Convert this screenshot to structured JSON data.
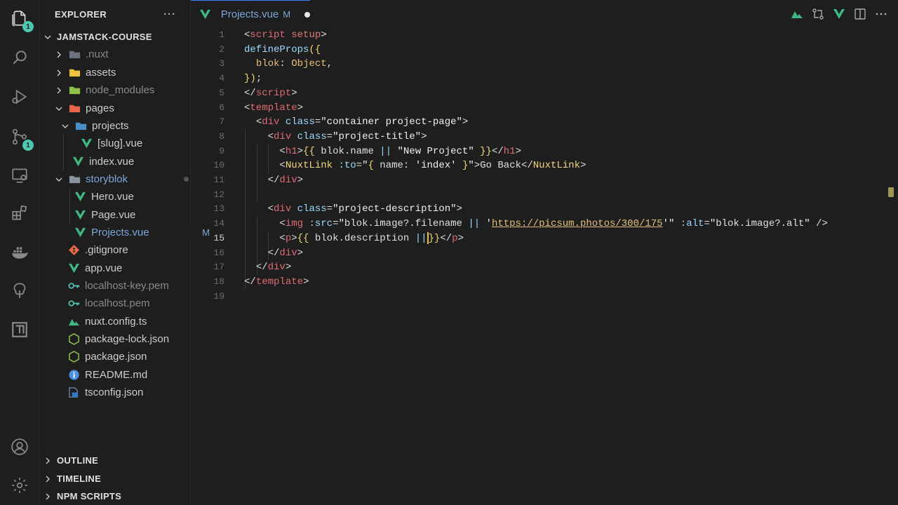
{
  "activity_bar": {
    "items": [
      {
        "name": "explorer-icon",
        "badge": "1"
      },
      {
        "name": "search-icon",
        "badge": ""
      },
      {
        "name": "run-debug-icon",
        "badge": ""
      },
      {
        "name": "source-control-icon",
        "badge": "1"
      },
      {
        "name": "remote-explorer-icon",
        "badge": ""
      },
      {
        "name": "extensions-icon",
        "badge": ""
      },
      {
        "name": "docker-icon",
        "badge": ""
      },
      {
        "name": "tree-icon",
        "badge": ""
      },
      {
        "name": "app-icon",
        "badge": ""
      }
    ],
    "bottom": [
      {
        "name": "account-icon"
      },
      {
        "name": "gear-icon"
      }
    ]
  },
  "sidebar": {
    "title": "EXPLORER",
    "more": "···",
    "root": "JAMSTACK-COURSE",
    "items": [
      {
        "label": ".nuxt",
        "type": "folder",
        "state": "collapsed",
        "dim": true
      },
      {
        "label": "assets",
        "type": "folder",
        "state": "collapsed"
      },
      {
        "label": "node_modules",
        "type": "folder",
        "state": "collapsed",
        "dim": true
      },
      {
        "label": "pages",
        "type": "folder",
        "state": "expanded"
      },
      {
        "label": "projects",
        "type": "folder",
        "state": "expanded"
      },
      {
        "label": "[slug].vue",
        "type": "vue"
      },
      {
        "label": "index.vue",
        "type": "vue"
      },
      {
        "label": "storyblok",
        "type": "folder",
        "state": "expanded",
        "modified": true
      },
      {
        "label": "Hero.vue",
        "type": "vue"
      },
      {
        "label": "Page.vue",
        "type": "vue"
      },
      {
        "label": "Projects.vue",
        "type": "vue",
        "modified": true,
        "deco": "M"
      },
      {
        "label": ".gitignore",
        "type": "git"
      },
      {
        "label": "app.vue",
        "type": "vue"
      },
      {
        "label": "localhost-key.pem",
        "type": "key",
        "dim": true
      },
      {
        "label": "localhost.pem",
        "type": "key",
        "dim": true
      },
      {
        "label": "nuxt.config.ts",
        "type": "nuxt"
      },
      {
        "label": "package-lock.json",
        "type": "node"
      },
      {
        "label": "package.json",
        "type": "node"
      },
      {
        "label": "README.md",
        "type": "info"
      },
      {
        "label": "tsconfig.json",
        "type": "ts"
      }
    ],
    "sections": [
      "OUTLINE",
      "TIMELINE",
      "NPM SCRIPTS"
    ]
  },
  "tab": {
    "label": "Projects.vue",
    "status": "M"
  },
  "editor": {
    "active_line": 15,
    "line_count": 19
  },
  "colors": {
    "accent": "#3b82f6",
    "vue_green": "#41b883",
    "badge": "#4ec9b0",
    "modified": "#7ba7d9"
  }
}
